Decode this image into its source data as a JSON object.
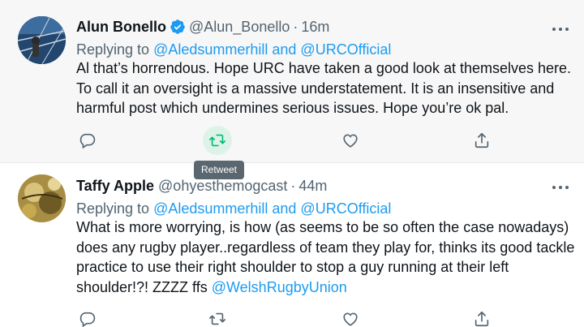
{
  "tweets": [
    {
      "author_name": "Alun Bonello",
      "verified": true,
      "handle": "@Alun_Bonello",
      "separator": "·",
      "time": "16m",
      "replying_prefix": "Replying to",
      "replying_mentions": "@Aledsummerhill and @URCOfficial",
      "text": "Al that’s horrendous. Hope URC have taken a good look at themselves here. To call it an oversight is a massive understatement. It is an insensitive and harmful post which undermines serious issues. Hope you’re ok pal.",
      "hovered_action": "retweet"
    },
    {
      "author_name": "Taffy Apple",
      "verified": false,
      "handle": "@ohyesthemogcast",
      "separator": "·",
      "time": "44m",
      "replying_prefix": "Replying to",
      "replying_mentions": "@Aledsummerhill and @URCOfficial",
      "text_main": "What is more worrying, is how (as seems to be so often the case nowadays) does any rugby player..regardless of team they play for, thinks its good tackle practice to use their right shoulder to stop a guy running at their left shoulder!?! ZZZZ ffs ",
      "text_mention": "@WelshRugbyUnion"
    }
  ],
  "tooltip": {
    "label": "Retweet"
  },
  "icons": {
    "reply": "reply-icon",
    "retweet": "retweet-icon",
    "like": "heart-icon",
    "share": "share-icon",
    "more": "more-dots-icon",
    "verified": "verified-badge-icon"
  },
  "colors": {
    "link": "#1d9bf0",
    "secondary_text": "#536471",
    "retweet_hover_bg": "#ddf3e8",
    "retweet_hover_icon": "#00ba7c",
    "tooltip_bg": "#5b6770"
  }
}
